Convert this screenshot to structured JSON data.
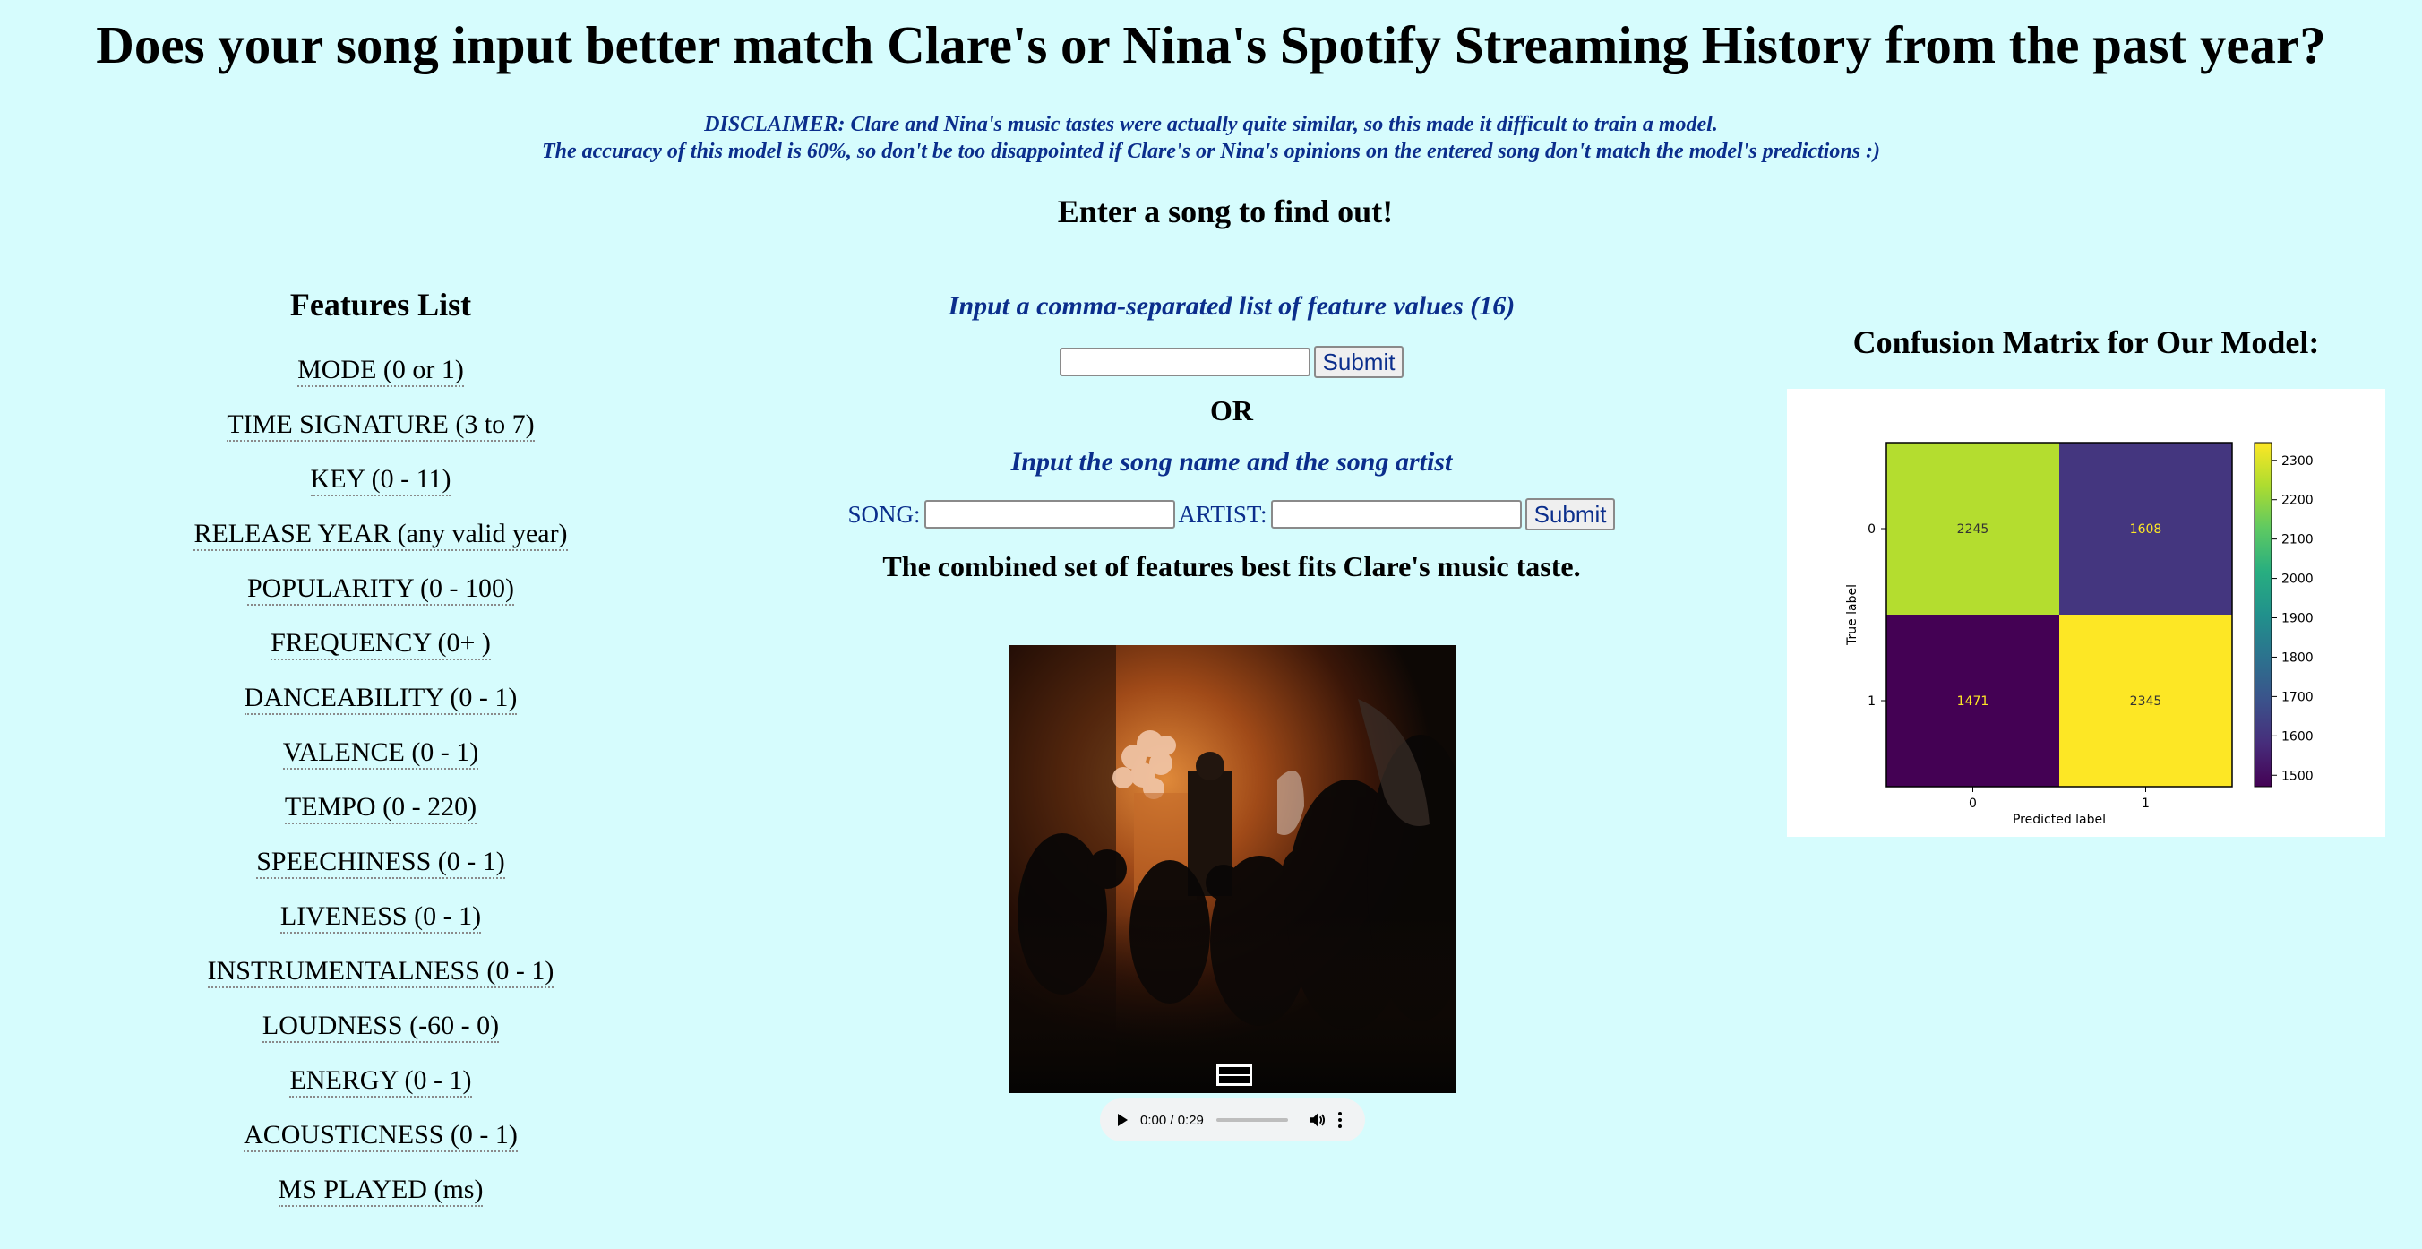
{
  "header": {
    "title": "Does your song input better match Clare's or Nina's Spotify Streaming History from the past year?",
    "disclaimer_line1": "DISCLAIMER: Clare and Nina's music tastes were actually quite similar, so this made it difficult to train a model.",
    "disclaimer_line2": "The accuracy of this model is 60%, so don't be too disappointed if Clare's or Nina's opinions on the entered song don't match the model's predictions :)",
    "subheading": "Enter a song to find out!"
  },
  "features": {
    "heading": "Features List",
    "items": [
      "MODE (0 or 1)",
      "TIME SIGNATURE (3 to 7)",
      "KEY (0 - 11)",
      "RELEASE YEAR (any valid year)",
      "POPULARITY (0 - 100)",
      "FREQUENCY (0+ )",
      "DANCEABILITY (0 - 1)",
      "VALENCE (0 - 1)",
      "TEMPO (0 - 220)",
      "SPEECHINESS (0 - 1)",
      "LIVENESS (0 - 1)",
      "INSTRUMENTALNESS (0 - 1)",
      "LOUDNESS (-60 - 0)",
      "ENERGY (0 - 1)",
      "ACOUSTICNESS (0 - 1)",
      "MS PLAYED (ms)"
    ]
  },
  "feature_form": {
    "prompt": "Input a comma-separated list of feature values (16)",
    "value": "",
    "submit_label": "Submit"
  },
  "or_label": "OR",
  "song_form": {
    "prompt": "Input the song name and the song artist",
    "song_label": "SONG:",
    "song_value": "",
    "artist_label": "ARTIST:",
    "artist_value": "",
    "submit_label": "Submit"
  },
  "result": {
    "text": "The combined set of features best fits Clare's music taste.",
    "album_art_icon": "album-cover-image"
  },
  "audio": {
    "time": "0:00 / 0:29",
    "progress": 0.0,
    "icons": [
      "play-icon",
      "volume-icon",
      "more-options-icon"
    ]
  },
  "confusion_matrix": {
    "title": "Confusion Matrix for Our Model:",
    "xlabel": "Predicted label",
    "ylabel": "True label",
    "xticks": [
      "0",
      "1"
    ],
    "yticks": [
      "0",
      "1"
    ],
    "cells": [
      [
        2245,
        1608
      ],
      [
        1471,
        2345
      ]
    ],
    "colorbar": {
      "min": 1471,
      "max": 2345,
      "ticks": [
        "1500",
        "1600",
        "1700",
        "1800",
        "1900",
        "2000",
        "2100",
        "2200",
        "2300"
      ],
      "colormap": "viridis"
    }
  },
  "chart_data": {
    "type": "heatmap",
    "title": "",
    "xlabel": "Predicted label",
    "ylabel": "True label",
    "x": [
      "0",
      "1"
    ],
    "y": [
      "0",
      "1"
    ],
    "values": [
      [
        2245,
        1608
      ],
      [
        1471,
        2345
      ]
    ],
    "colorbar_range": [
      1471,
      2345
    ],
    "colormap": "viridis"
  }
}
